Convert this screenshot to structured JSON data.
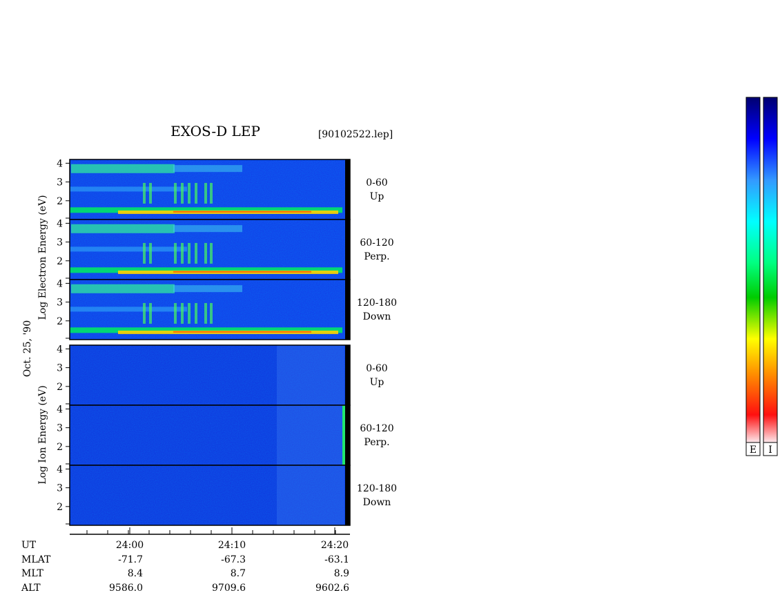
{
  "chart_data": {
    "type": "heatmap",
    "title": "EXOS-D LEP",
    "file_id": "[90102522.lep]",
    "date_label": "Oct. 25, '90",
    "electron_label": "Log   Electron   Energy (eV)",
    "ion_label": "Log   Ion   Energy (eV)",
    "y_ticks": [
      "4",
      "3",
      "2"
    ],
    "ylim": [
      1,
      4.2
    ],
    "panels": [
      {
        "group": "electron",
        "angle": "0-60",
        "direction": "Up"
      },
      {
        "group": "electron",
        "angle": "60-120",
        "direction": "Perp."
      },
      {
        "group": "electron",
        "angle": "120-180",
        "direction": "Down"
      },
      {
        "group": "ion",
        "angle": "0-60",
        "direction": "Up"
      },
      {
        "group": "ion",
        "angle": "60-120",
        "direction": "Perp."
      },
      {
        "group": "ion",
        "angle": "120-180",
        "direction": "Down"
      }
    ],
    "x_ticks": [
      "24:00",
      "24:10",
      "24:20"
    ],
    "ephemeris": {
      "labels": [
        "UT",
        "MLAT",
        "MLT",
        "ALT"
      ],
      "columns": [
        {
          "mlat": "-71.7",
          "mlt": "8.4",
          "alt": "9586.0"
        },
        {
          "mlat": "-67.3",
          "mlt": "8.7",
          "alt": "9709.6"
        },
        {
          "mlat": "-63.1",
          "mlt": "8.9",
          "alt": "9602.6"
        }
      ]
    },
    "colorbar": {
      "labels": [
        "E",
        "I"
      ],
      "colors": [
        "#fce8ea",
        "#ff0000",
        "#ff8c00",
        "#ffff00",
        "#00c800",
        "#00ffff",
        "#3399ff",
        "#0000ff",
        "#000080"
      ]
    }
  }
}
